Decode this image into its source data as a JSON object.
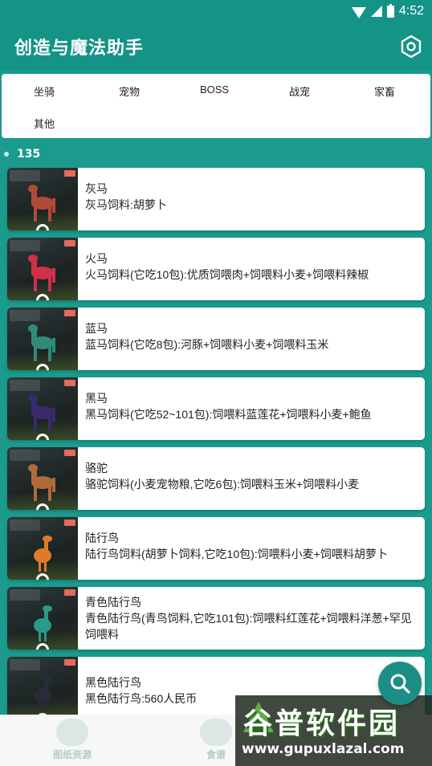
{
  "status_bar": {
    "time": "4:52"
  },
  "app_bar": {
    "title": "创造与魔法助手",
    "settings_icon": "hexagon-settings-icon"
  },
  "tabs": [
    "坐骑",
    "宠物",
    "BOSS",
    "战宠",
    "家畜",
    "其他"
  ],
  "count": "135",
  "items": [
    {
      "name": "灰马",
      "desc": "灰马饲料:胡萝卜",
      "color": "#b24a3a"
    },
    {
      "name": "火马",
      "desc": "火马饲料(它吃10包):优质饲喂肉+饲喂料小麦+饲喂料辣椒",
      "color": "#d0304a"
    },
    {
      "name": "蓝马",
      "desc": "蓝马饲料(它吃8包):河豚+饲喂料小麦+饲喂料玉米",
      "color": "#2f8a7a"
    },
    {
      "name": "黑马",
      "desc": "黑马饲料(它吃52~101包):饲喂料蓝莲花+饲喂料小麦+鲍鱼",
      "color": "#3a2a6a"
    },
    {
      "name": "骆驼",
      "desc": "骆驼饲料(小麦宠物粮,它吃6包):饲喂料玉米+饲喂料小麦",
      "color": "#b06a38"
    },
    {
      "name": "陆行鸟",
      "desc": "陆行鸟饲料(胡萝卜饲料,它吃10包):饲喂料小麦+饲喂料胡萝卜",
      "color": "#e07a2a"
    },
    {
      "name": "青色陆行鸟",
      "desc": "青色陆行鸟(青鸟饲料,它吃101包):饲喂料红莲花+饲喂料洋葱+罕见饲喂料",
      "color": "#2a9a8a"
    },
    {
      "name": "黑色陆行鸟",
      "desc": "黑色陆行鸟:560人民币",
      "color": "#2a2a38"
    }
  ],
  "fab": {
    "icon": "search-icon"
  },
  "bottom_nav": [
    {
      "label": "图纸资源",
      "icon": "blueprint-icon"
    },
    {
      "label": "食谱",
      "icon": "recipe-icon"
    }
  ],
  "watermark": {
    "title": "谷普软件园",
    "url": "www.gupuxlazal.com"
  }
}
